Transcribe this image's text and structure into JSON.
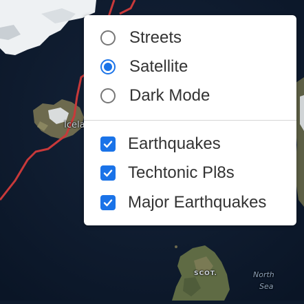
{
  "map": {
    "labels": {
      "iceland": "Icela",
      "scotland": "SCOT.",
      "north": "North",
      "sea": "Sea"
    },
    "colors": {
      "ocean": "#0d1a2c",
      "plate_boundary": "#c8393a"
    }
  },
  "layer_control": {
    "base_layers": [
      {
        "label": "Streets",
        "selected": false
      },
      {
        "label": "Satellite",
        "selected": true
      },
      {
        "label": "Dark Mode",
        "selected": false
      }
    ],
    "overlays": [
      {
        "label": "Earthquakes",
        "checked": true
      },
      {
        "label": "Techtonic Pl8s",
        "checked": true
      },
      {
        "label": "Major Earthquakes",
        "checked": true
      }
    ],
    "accent_color": "#1a73e8"
  }
}
